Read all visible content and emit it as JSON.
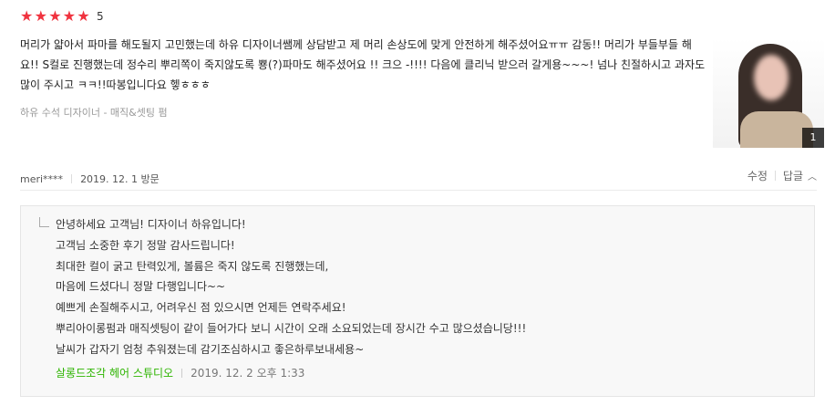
{
  "review": {
    "rating_stars": 5,
    "score": "5",
    "text": "머리가 얇아서 파마를 해도될지 고민했는데 하유 디자이너쌤께 상담받고 제 머리 손상도에 맞게 안전하게 해주셨어요ㅠㅠ 감동!! 머리가 부들부들 해요!! S컬로 진행했는데 정수리 뿌리쪽이 죽지않도록 뿅(?)파마도 해주셨어요 !! 크으 -!!!! 다음에 클리닉 받으러 갈게용~~~! 넘나 친절하시고 과자도 많이 주시고 ㅋㅋ!!따봉입니다요 헿ㅎㅎㅎ",
    "service_info": "하유 수석 디자이너 - 매직&셋팅 펌",
    "photo_count": "1",
    "author": "meri****",
    "visit_date": "2019. 12. 1 방문"
  },
  "actions": {
    "edit_label": "수정",
    "reply_label": "답글"
  },
  "reply": {
    "lines": [
      "안녕하세요 고객님! 디자이너 하유입니다!",
      "고객님 소중한 후기 정말 감사드립니다!",
      "최대한 컬이 굵고 탄력있게, 볼륨은 죽지 않도록 진행했는데,",
      "마음에 드셨다니 정말 다행입니다~~",
      "예쁘게 손질해주시고, 어려우신 점 있으시면 언제든 연락주세요!",
      "뿌리아이롱펌과 매직셋팅이 같이 들어가다 보니 시간이 오래 소요되었는데 장시간 수고 많으셨습니당!!!",
      "날씨가 갑자기 엄청 추워졌는데 감기조심하시고 좋은하루보내세용~"
    ],
    "shop_name": "살롱드조각 헤어 스튜디오",
    "date": "2019. 12. 2 오후 1:33"
  },
  "colors": {
    "star": "#f0333f",
    "shop_name": "#2db400"
  },
  "icons": {
    "star": "star-icon",
    "chevron": "chevron-up-icon",
    "corner": "reply-corner-icon"
  }
}
